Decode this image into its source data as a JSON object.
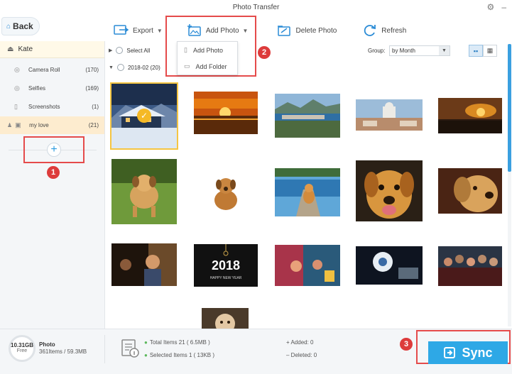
{
  "window": {
    "title": "Photo Transfer"
  },
  "nav": {
    "back_label": "Back"
  },
  "toolbar": {
    "export_label": "Export",
    "add_photo_label": "Add Photo",
    "delete_label": "Delete Photo",
    "refresh_label": "Refresh"
  },
  "add_photo_menu": {
    "items": [
      "Add Photo",
      "Add Folder"
    ]
  },
  "sidebar": {
    "device_name": "Kate",
    "albums": [
      {
        "name": "Camera Roll",
        "count": "(170)",
        "icon": "camera-icon"
      },
      {
        "name": "Selfies",
        "count": "(169)",
        "icon": "camera-icon"
      },
      {
        "name": "Screenshots",
        "count": "(1)",
        "icon": "phone-icon"
      },
      {
        "name": "my love",
        "count": "(21)",
        "icon": "photo-album-icon"
      }
    ],
    "add_album_symbol": "+"
  },
  "main": {
    "select_all_label": "Select All",
    "group_label": "Group:",
    "group_value": "by Month",
    "date_group": "2018-02 (20)"
  },
  "photos": [
    {
      "name": "snowy cabin",
      "selected": true
    },
    {
      "name": "orange sunset"
    },
    {
      "name": "coastal city"
    },
    {
      "name": "hilltop church"
    },
    {
      "name": "sunset clouds"
    },
    {
      "name": "running puppy"
    },
    {
      "name": "sitting puppy"
    },
    {
      "name": "dog on pier"
    },
    {
      "name": "smiling dog"
    },
    {
      "name": "golden retriever"
    },
    {
      "name": "movie scene boy"
    },
    {
      "name": "2018 happy new year"
    },
    {
      "name": "animated movie scene"
    },
    {
      "name": "robot movie"
    },
    {
      "name": "superhero group"
    },
    {
      "name": "puppy partial"
    }
  ],
  "new_year_text": {
    "year": "2018",
    "greeting": "HAPPY NEW YEAR"
  },
  "status": {
    "storage_gb": "10.31GB",
    "storage_free": "Free",
    "category": "Photo",
    "category_stats": "361Items / 59.3MB",
    "total_items": "Total Items 21 ( 6.5MB )",
    "selected_items": "Selected Items 1 ( 13KB )",
    "added": "Added: 0",
    "deleted": "Deleted: 0",
    "sync_label": "Sync"
  },
  "markers": [
    "1",
    "2",
    "3"
  ],
  "colors": {
    "accent": "#2ea8e6",
    "highlight": "#e54b4b",
    "selection": "#f5c542"
  }
}
